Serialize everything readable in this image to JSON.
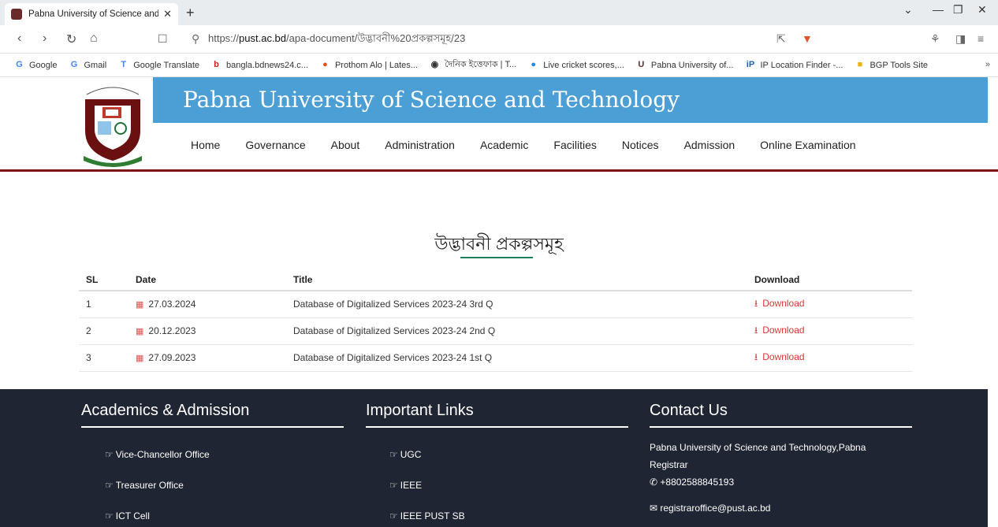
{
  "browser": {
    "tab_title": "Pabna University of Science and",
    "url_prefix": "https://",
    "url_host": "pust.ac.bd",
    "url_path": "/apa-document/উদ্ভাবনী%20প্রকল্পসমূহ/23",
    "bookmarks": [
      {
        "label": "Google",
        "icon": "G",
        "color": "#4285f4"
      },
      {
        "label": "Gmail",
        "icon": "G",
        "color": "#4285f4"
      },
      {
        "label": "Google Translate",
        "icon": "T",
        "color": "#4285f4"
      },
      {
        "label": "bangla.bdnews24.c...",
        "icon": "b",
        "color": "#d02020"
      },
      {
        "label": "Prothom Alo | Lates...",
        "icon": "●",
        "color": "#e8501a"
      },
      {
        "label": "দৈনিক ইত্তেফাক | T...",
        "icon": "◉",
        "color": "#333"
      },
      {
        "label": "Live cricket scores,...",
        "icon": "●",
        "color": "#1e88e5"
      },
      {
        "label": "Pabna University of...",
        "icon": "U",
        "color": "#6b2a2a"
      },
      {
        "label": "IP Location Finder -...",
        "icon": "iP",
        "color": "#1565c0"
      },
      {
        "label": "BGP Tools Site",
        "icon": "■",
        "color": "#f0b400"
      }
    ],
    "more": "»"
  },
  "site": {
    "title": "Pabna University of Science and Technology",
    "nav": [
      "Home",
      "Governance",
      "About",
      "Administration",
      "Academic",
      "Facilities",
      "Notices",
      "Admission",
      "Online Examination"
    ]
  },
  "main": {
    "heading": "উদ্ভাবনী প্রকল্পসমূহ",
    "table": {
      "headers": {
        "sl": "SL",
        "date": "Date",
        "title": "Title",
        "download": "Download"
      },
      "rows": [
        {
          "sl": "1",
          "date": "27.03.2024",
          "title": "Database of Digitalized Services 2023-24 3rd Q",
          "download": "Download"
        },
        {
          "sl": "2",
          "date": "20.12.2023",
          "title": "Database of Digitalized Services 2023-24 2nd Q",
          "download": "Download"
        },
        {
          "sl": "3",
          "date": "27.09.2023",
          "title": "Database of Digitalized Services 2023-24 1st Q",
          "download": "Download"
        }
      ]
    }
  },
  "footer": {
    "academics": {
      "heading": "Academics & Admission",
      "links": [
        "Vice-Chancellor Office",
        "Treasurer Office",
        "ICT Cell"
      ]
    },
    "links": {
      "heading": "Important Links",
      "links": [
        "UGC",
        "IEEE",
        "IEEE PUST SB"
      ]
    },
    "contact": {
      "heading": "Contact Us",
      "org": "Pabna University of Science and Technology,Pabna",
      "role": "Registrar",
      "phone": "+8802588845193",
      "email": "registraroffice@pust.ac.bd"
    }
  },
  "colors": {
    "banner_blue": "#4b9fd5",
    "accent_red": "#7c1515",
    "footer_bg": "#1f2532",
    "download_red": "#d33"
  }
}
